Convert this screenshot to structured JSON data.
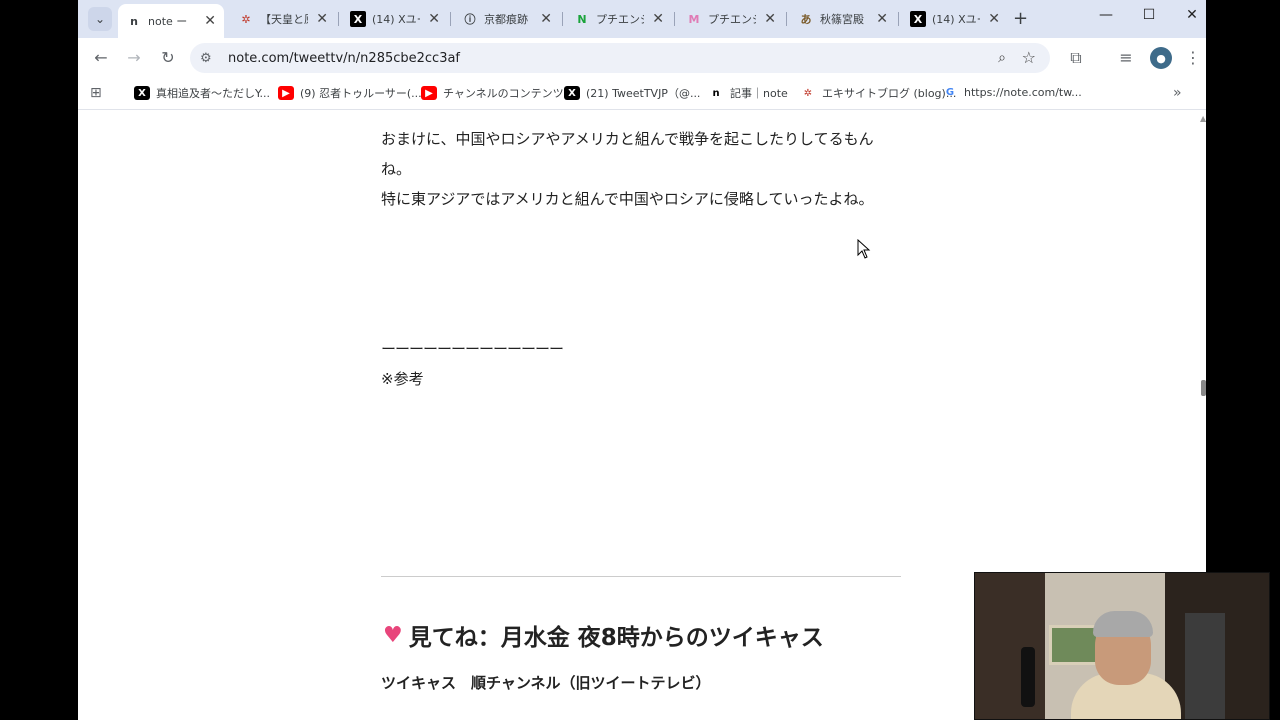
{
  "tabs": [
    {
      "favicon": "note-icon",
      "fav_text": "n",
      "fav_color": "#000000",
      "title": "note ー",
      "active": true
    },
    {
      "favicon": "excite-icon",
      "fav_text": "✲",
      "fav_color": "#c0392b",
      "title": "【天皇と原",
      "active": false
    },
    {
      "favicon": "x-icon",
      "fav_text": "X",
      "fav_color": "#000000",
      "title": "(14) Xユー",
      "active": false
    },
    {
      "favicon": "info-icon",
      "fav_text": "ⓘ",
      "fav_color": "#333333",
      "title": "京都痕跡",
      "active": false
    },
    {
      "favicon": "n-green-icon",
      "fav_text": "N",
      "fav_color": "#1aa33b",
      "title": "プチエンジ",
      "active": false
    },
    {
      "favicon": "m-pink-icon",
      "fav_text": "M",
      "fav_color": "#e07bb5",
      "title": "プチエンジ",
      "active": false
    },
    {
      "favicon": "site-icon",
      "fav_text": "あ",
      "fav_color": "#7a5b2a",
      "title": "秋篠宮殿",
      "active": false
    },
    {
      "favicon": "x-icon",
      "fav_text": "X",
      "fav_color": "#000000",
      "title": "(14) Xユー",
      "active": false
    }
  ],
  "address": {
    "url": "note.com/tweettv/n/n285cbe2cc3af"
  },
  "bookmarks": [
    {
      "fav_text": "X",
      "fav_color": "#000000",
      "fav_text_color": "#ffffff",
      "label": "真相追及者〜ただしY..."
    },
    {
      "fav_text": "▶",
      "fav_color": "#ff0000",
      "fav_text_color": "#ffffff",
      "label": "(9) 忍者トゥルーサー(..."
    },
    {
      "fav_text": "▶",
      "fav_color": "#ff0000",
      "fav_text_color": "#ffffff",
      "label": "チャンネルのコンテンツ..."
    },
    {
      "fav_text": "X",
      "fav_color": "#000000",
      "fav_text_color": "#ffffff",
      "label": "(21) TweetTVJP（@..."
    },
    {
      "fav_text": "n",
      "fav_color": "#ffffff",
      "fav_text_color": "#000000",
      "label": "記事｜note"
    },
    {
      "fav_text": "✲",
      "fav_color": "#ffffff",
      "fav_text_color": "#c0392b",
      "label": "エキサイトブログ (blog)..."
    },
    {
      "fav_text": "G",
      "fav_color": "#ffffff",
      "fav_text_color": "#4285f4",
      "label": "https://note.com/tw..."
    }
  ],
  "article": {
    "line1": "おまけに、中国やロシアやアメリカと組んで戦争を起こしたりしてるもん",
    "line2": "ね。",
    "line3": "特に東アジアではアメリカと組んで中国やロシアに侵略していったよね。",
    "dashes": "ーーーーーーーーーーーーー",
    "reference": "※参考",
    "heading": "見てね：月水金 夜8時からのツイキャス",
    "subheading": "ツイキャス　順チャンネル（旧ツイートテレビ）"
  }
}
